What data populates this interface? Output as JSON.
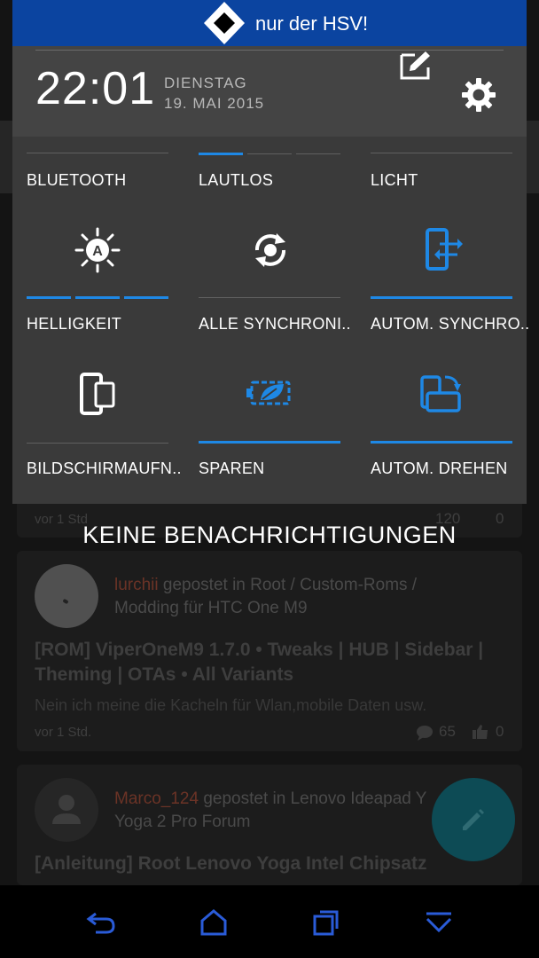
{
  "status_banner": {
    "text": "nur der HSV!"
  },
  "header": {
    "time": "22:01",
    "weekday": "DIENSTAG",
    "date": "19. MAI 2015"
  },
  "tiles": [
    {
      "label": "BLUETOOTH"
    },
    {
      "label": "LAUTLOS"
    },
    {
      "label": "LICHT"
    },
    {
      "label": "HELLIGKEIT"
    },
    {
      "label": "ALLE SYNCHRONI.."
    },
    {
      "label": "AUTOM. SYNCHRO.."
    },
    {
      "label": "BILDSCHIRMAUFN.."
    },
    {
      "label": "SPAREN"
    },
    {
      "label": "AUTOM. DREHEN"
    }
  ],
  "notifications": {
    "empty_text": "KEINE BENACHRICHTIGUNGEN"
  },
  "feed": {
    "post0": {
      "time": "vor 1 Std",
      "comments": "120",
      "likes": "0"
    },
    "post1": {
      "user": "lurchii",
      "action_line1": " gepostet in Root / Custom-Roms /",
      "action_line2": "Modding für HTC One M9",
      "title_line1": "[ROM] ViperOneM9 1.7.0 • Tweaks | HUB | Sidebar |",
      "title_line2": "Theming | OTAs • All Variants",
      "excerpt": "Nein ich meine die Kacheln für Wlan,mobile Daten usw.",
      "time": "vor 1 Std.",
      "comments": "65",
      "likes": "0"
    },
    "post2": {
      "user": "Marco_124",
      "action_line1": " gepostet in Lenovo Ideapad Y",
      "action_line2": "Yoga 2 Pro Forum",
      "title_line1": "[Anleitung] Root Lenovo Yoga Intel Chipsatz"
    }
  },
  "colors": {
    "accent": "#1e88e5",
    "banner": "#0b44a0",
    "shade": "#3a3a3a",
    "fab": "#0d4b55"
  }
}
